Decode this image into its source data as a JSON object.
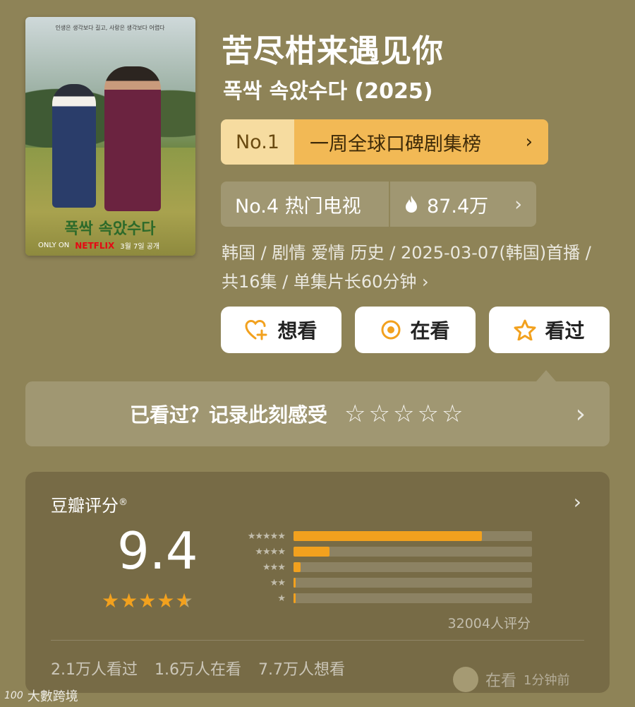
{
  "poster": {
    "tagline": "인생은 생각보다 길고, 사랑은 생각보다 어렵다",
    "title_kr": "폭싹 속았수다",
    "only_on": "ONLY ON",
    "netflix": "NETFLIX",
    "date": "3월 7일 공개"
  },
  "title": "苦尽柑来遇见你",
  "subtitle": "폭싹 속았수다 (2025)",
  "rank_global": {
    "no": "No.1",
    "label": "一周全球口碑剧集榜",
    "chevron": "›"
  },
  "rank_hot": {
    "no": "No.4 热门电视",
    "icon": "flame-icon",
    "value": "87.4万",
    "chevron": "›"
  },
  "meta": "韩国 / 剧情 爱情 历史 / 2025-03-07(韩国)首播 / 共16集 / 单集片长60分钟 ›",
  "buttons": [
    {
      "label": "想看",
      "icon": "heart-plus-icon"
    },
    {
      "label": "在看",
      "icon": "target-icon"
    },
    {
      "label": "看过",
      "icon": "star-icon"
    }
  ],
  "record": {
    "text": "已看过？记录此刻感受",
    "stars": "☆☆☆☆☆",
    "chevron": "›"
  },
  "rating": {
    "source": "豆瓣评分",
    "mark": "®",
    "score": "9.4",
    "stars": 4.7,
    "count": "32004人评分",
    "distribution": [
      {
        "label": "★★★★★",
        "percent": 79
      },
      {
        "label": "★★★★",
        "percent": 15
      },
      {
        "label": "★★★",
        "percent": 3
      },
      {
        "label": "★★",
        "percent": 0.7
      },
      {
        "label": "★",
        "percent": 0.7
      }
    ],
    "stats": {
      "watched": "2.1万人看过",
      "watching": "1.6万人在看",
      "want": "7.7万人想看"
    }
  },
  "mini_status": {
    "label": "在看",
    "time": "1分钟前"
  },
  "watermark": {
    "logo": "100",
    "text": "大數跨境"
  },
  "colors": {
    "background": "#8e8357",
    "accent": "#f2a11e",
    "rank_light": "#f6dca0",
    "rank_dark": "#f2b955"
  }
}
